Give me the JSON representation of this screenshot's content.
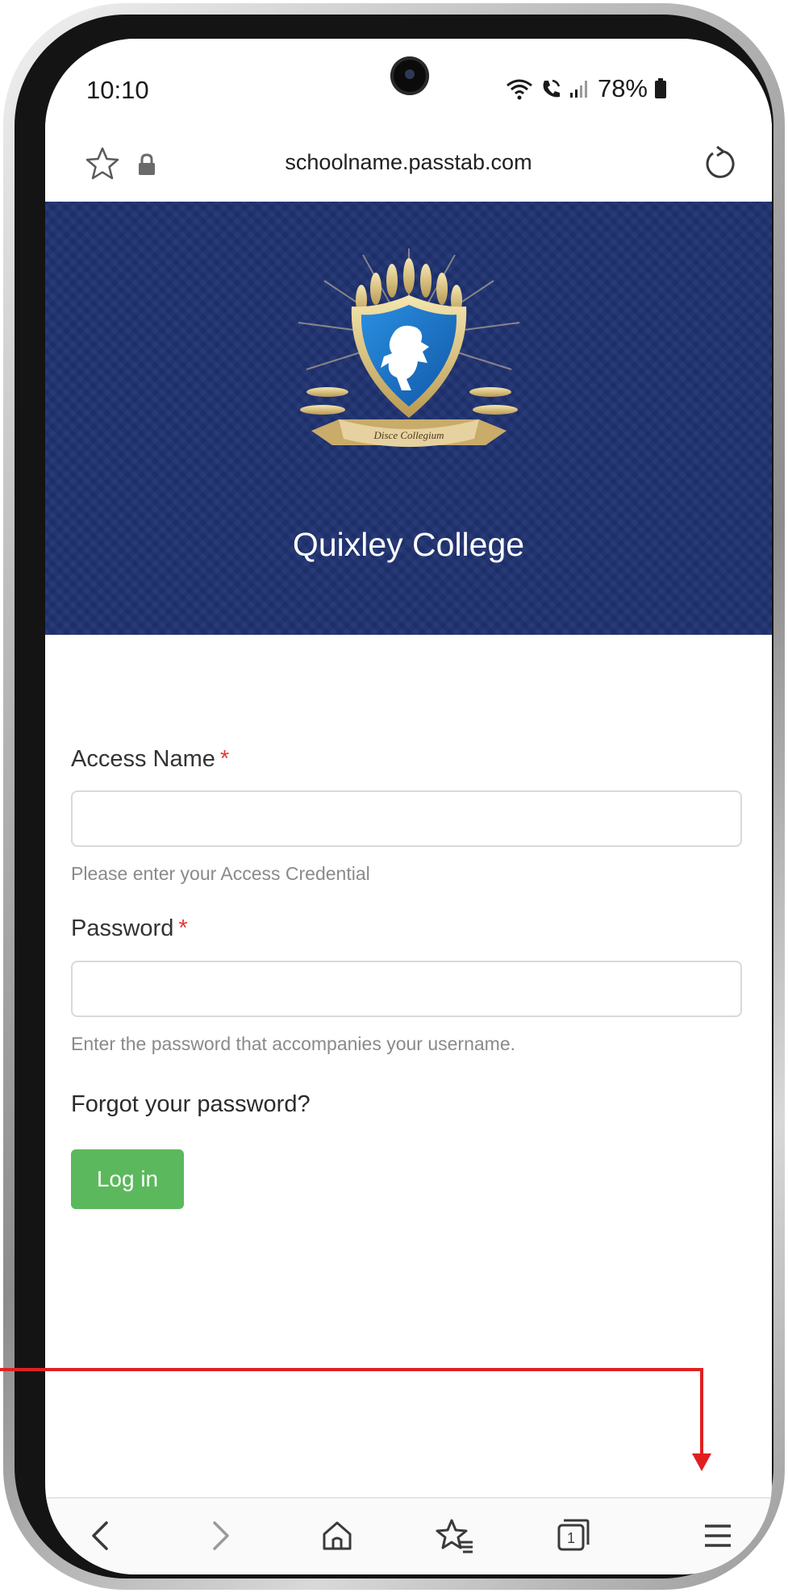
{
  "status_bar": {
    "time": "10:10",
    "battery": "78%",
    "icons": [
      "wifi-icon",
      "wifi-call-icon",
      "signal-icon",
      "battery-icon"
    ]
  },
  "browser": {
    "url": "schoolname.passtab.com",
    "icons": [
      "star-icon",
      "lock-icon",
      "reload-icon"
    ]
  },
  "hero": {
    "crest_motto": "Disce Collegium",
    "title": "Quixley College",
    "background_color": "#1f3270"
  },
  "form": {
    "access_name": {
      "label": "Access Name",
      "required_mark": "*",
      "value": "",
      "help": "Please enter your Access Credential"
    },
    "password": {
      "label": "Password",
      "required_mark": "*",
      "value": "",
      "help": "Enter the password that accompanies your username."
    },
    "forgot_link": "Forgot your password?",
    "login_button": "Log in",
    "login_button_color": "#5cb85c"
  },
  "bottom_nav": {
    "items": [
      "back-icon",
      "forward-icon",
      "home-icon",
      "bookmarks-icon",
      "tabs-icon",
      "menu-icon"
    ],
    "tab_count": "1"
  },
  "annotation": {
    "color": "#e02020",
    "target": "menu-icon"
  }
}
